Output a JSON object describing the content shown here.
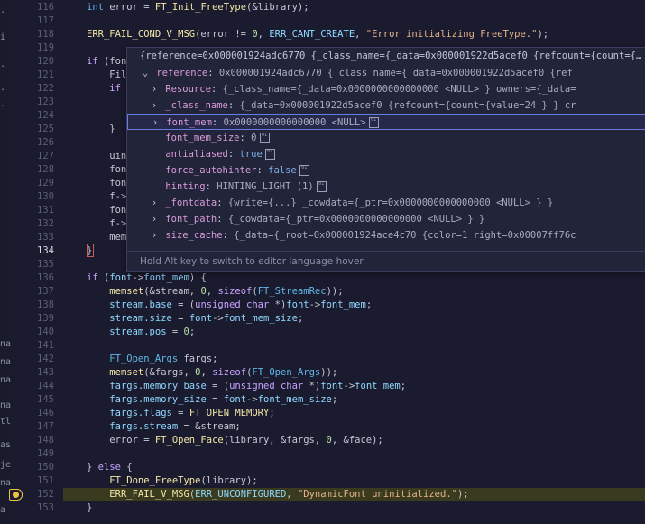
{
  "sidebar": {
    "chars": [
      ".",
      "i",
      ".",
      ".",
      ".",
      "na",
      "na",
      "na",
      "na",
      "tl",
      "as",
      "je",
      "na",
      "a"
    ]
  },
  "code": {
    "lines": [
      {
        "n": "116",
        "html": "<span class='ty'>int</span> error = <span class='fn'>FT_Init_FreeType</span>(&amp;library);"
      },
      {
        "n": "117",
        "html": ""
      },
      {
        "n": "118",
        "html": "<span class='mac'>ERR_FAIL_COND_V_MSG</span>(error != <span class='num'>0</span>, <span class='mem'>ERR_CANT_CREATE</span>, <span class='str'>\"Error initializing FreeType.\"</span>);"
      },
      {
        "n": "119",
        "html": ""
      },
      {
        "n": "120",
        "html": "<span class='kw'>if</span> (fon"
      },
      {
        "n": "121",
        "html": "    Fil"
      },
      {
        "n": "122",
        "html": "    <span class='kw'>if</span>"
      },
      {
        "n": "123",
        "html": ""
      },
      {
        "n": "124",
        "html": ""
      },
      {
        "n": "125",
        "html": "    }"
      },
      {
        "n": "126",
        "html": ""
      },
      {
        "n": "127",
        "html": "    uin"
      },
      {
        "n": "128",
        "html": "    fon"
      },
      {
        "n": "129",
        "html": "    fon"
      },
      {
        "n": "130",
        "html": "    f->"
      },
      {
        "n": "131",
        "html": "    fon"
      },
      {
        "n": "132",
        "html": "    f->"
      },
      {
        "n": "133",
        "html": "    mem"
      },
      {
        "n": "134",
        "html": "}"
      },
      {
        "n": "135",
        "html": ""
      },
      {
        "n": "136",
        "html": "<span class='kw'>if</span> (<span class='mem'>font</span>-><span class='mem'>font_mem</span>) {"
      },
      {
        "n": "137",
        "html": "    <span class='fn'>memset</span>(&amp;stream, <span class='num'>0</span>, <span class='kw'>sizeof</span>(<span class='ty'>FT_StreamRec</span>));"
      },
      {
        "n": "138",
        "html": "    <span class='mem'>stream.base</span> = (<span class='kw'>unsigned char</span> *)<span class='mem'>font</span>-><span class='mem'>font_mem</span>;"
      },
      {
        "n": "139",
        "html": "    <span class='mem'>stream.size</span> = <span class='mem'>font</span>-><span class='mem'>font_mem_size</span>;"
      },
      {
        "n": "140",
        "html": "    <span class='mem'>stream.pos</span> = <span class='num'>0</span>;"
      },
      {
        "n": "141",
        "html": ""
      },
      {
        "n": "142",
        "html": "    <span class='ty'>FT_Open_Args</span> fargs;"
      },
      {
        "n": "143",
        "html": "    <span class='fn'>memset</span>(&amp;fargs, <span class='num'>0</span>, <span class='kw'>sizeof</span>(<span class='ty'>FT_Open_Args</span>));"
      },
      {
        "n": "144",
        "html": "    <span class='mem'>fargs.memory_base</span> = (<span class='kw'>unsigned char</span> *)<span class='mem'>font</span>-><span class='mem'>font_mem</span>;"
      },
      {
        "n": "145",
        "html": "    <span class='mem'>fargs.memory_size</span> = <span class='mem'>font</span>-><span class='mem'>font_mem_size</span>;"
      },
      {
        "n": "146",
        "html": "    <span class='mem'>fargs.flags</span> = <span class='mac'>FT_OPEN_MEMORY</span>;"
      },
      {
        "n": "147",
        "html": "    <span class='mem'>fargs.stream</span> = &amp;stream;"
      },
      {
        "n": "148",
        "html": "    error = <span class='fn'>FT_Open_Face</span>(library, &amp;fargs, <span class='num'>0</span>, &amp;face);"
      },
      {
        "n": "149",
        "html": ""
      },
      {
        "n": "150",
        "html": "} <span class='kw'>else</span> {"
      },
      {
        "n": "151",
        "html": "    <span class='fn'>FT_Done_FreeType</span>(library);"
      },
      {
        "n": "152",
        "html": "    <span class='mac'>ERR_FAIL_V_MSG</span>(<span class='mem'>ERR_UNCONFIGURED</span>, <span class='str'>\"DynamicFont uninitialized.\"</span>);"
      },
      {
        "n": "153",
        "html": "}"
      }
    ]
  },
  "hover": {
    "header": "{reference=0x000001924adc6770 {_class_name={_data=0x000001922d5acef0 {refcount={count={…",
    "rows": [
      {
        "chev": "⌄",
        "indent": 0,
        "name": "reference",
        "value": "0x000001924adc6770 {_class_name={_data=0x000001922d5acef0 {ref",
        "bin": false
      },
      {
        "chev": "›",
        "indent": 1,
        "name": "Resource",
        "value": "{_class_name={_data=0x0000000000000000 <NULL> } owners={_data=",
        "bin": false
      },
      {
        "chev": "›",
        "indent": 1,
        "name": "_class_name",
        "value": "{_data=0x000001922d5acef0 {refcount={count={value=24 } } cr",
        "bin": false
      },
      {
        "chev": "›",
        "indent": 1,
        "name": "font_mem",
        "value": "0x0000000000000000 <NULL>",
        "bin": true
      },
      {
        "chev": "",
        "indent": 1,
        "name": "font_mem_size",
        "value": "0",
        "bin": true
      },
      {
        "chev": "",
        "indent": 1,
        "name": "antialiased",
        "value": "true",
        "bin": true
      },
      {
        "chev": "",
        "indent": 1,
        "name": "force_autohinter",
        "value": "false",
        "bin": true
      },
      {
        "chev": "",
        "indent": 1,
        "name": "hinting",
        "value": "HINTING_LIGHT (1)",
        "bin": true
      },
      {
        "chev": "›",
        "indent": 1,
        "name": "_fontdata",
        "value": "{write={...} _cowdata={_ptr=0x0000000000000000 <NULL> } }",
        "bin": false
      },
      {
        "chev": "›",
        "indent": 1,
        "name": "font_path",
        "value": "{_cowdata={_ptr=0x0000000000000000 <NULL> } }",
        "bin": false
      },
      {
        "chev": "›",
        "indent": 1,
        "name": "size_cache",
        "value": "{_data={_root=0x000001924ace4c70 {color=1 right=0x00007ff76c",
        "bin": false
      }
    ],
    "footer": "Hold Alt key to switch to editor language hover"
  },
  "colors": {
    "highlight": "#3a3a1e",
    "breakpoint": "#f0c23c"
  }
}
